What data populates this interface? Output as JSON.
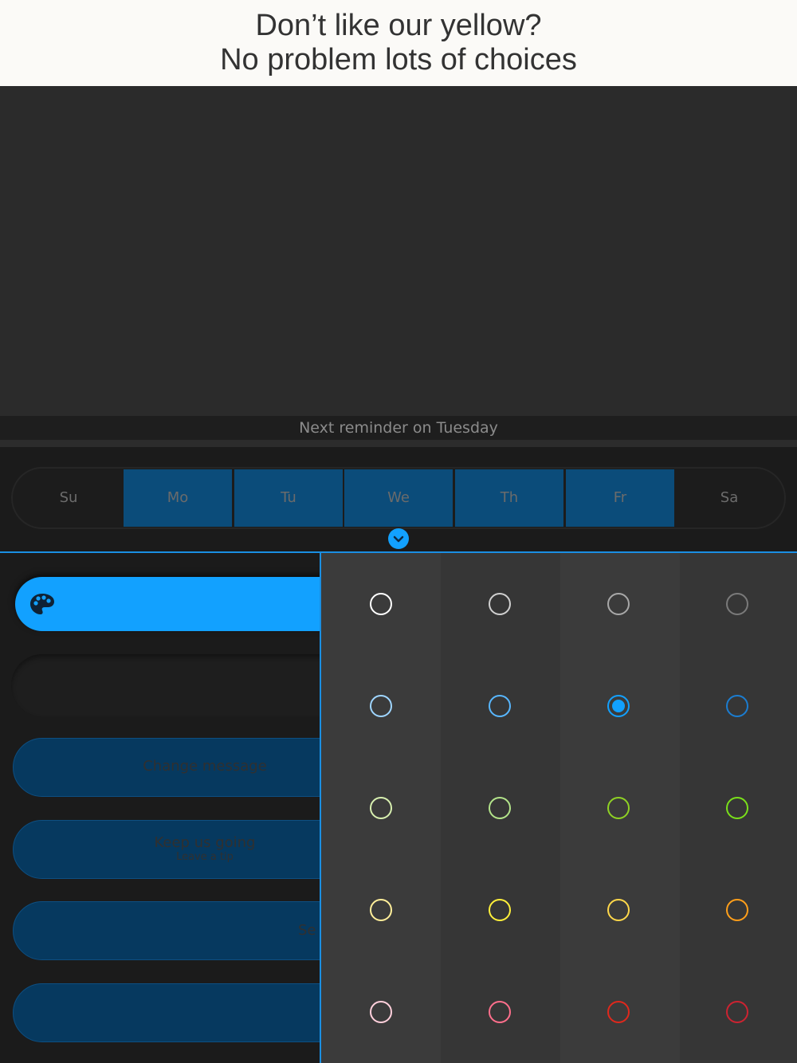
{
  "promo": {
    "line1": "Don’t like our yellow?",
    "line2": "No problem lots of choices"
  },
  "status": {
    "next_reminder": "Next reminder on Tuesday"
  },
  "days": [
    {
      "label": "Su",
      "active": false
    },
    {
      "label": "Mo",
      "active": true
    },
    {
      "label": "Tu",
      "active": true
    },
    {
      "label": "We",
      "active": true
    },
    {
      "label": "Th",
      "active": true
    },
    {
      "label": "Fr",
      "active": true
    },
    {
      "label": "Sa",
      "active": false
    }
  ],
  "buttons": {
    "change_message": "Change message",
    "keep_going": "Keep us going",
    "keep_going_sub": "Leave a tip",
    "partial": "Se"
  },
  "colors": {
    "accent": "#12a1ff",
    "swatches": [
      [
        "#ffffff",
        "#d0d0d0",
        "#a8a8a8",
        "#7a7a7a"
      ],
      [
        "#9fd6ff",
        "#58b7ff",
        "#12a1ff",
        "#1b7dd1"
      ],
      [
        "#d8f0b0",
        "#b3e48a",
        "#8fd224",
        "#7ae01a"
      ],
      [
        "#ffef9a",
        "#fff03a",
        "#ffd84a",
        "#ff9f1a"
      ],
      [
        "#ffd0dc",
        "#ff6f8c",
        "#e0281c",
        "#cc2331"
      ]
    ],
    "selected": [
      1,
      2
    ]
  }
}
